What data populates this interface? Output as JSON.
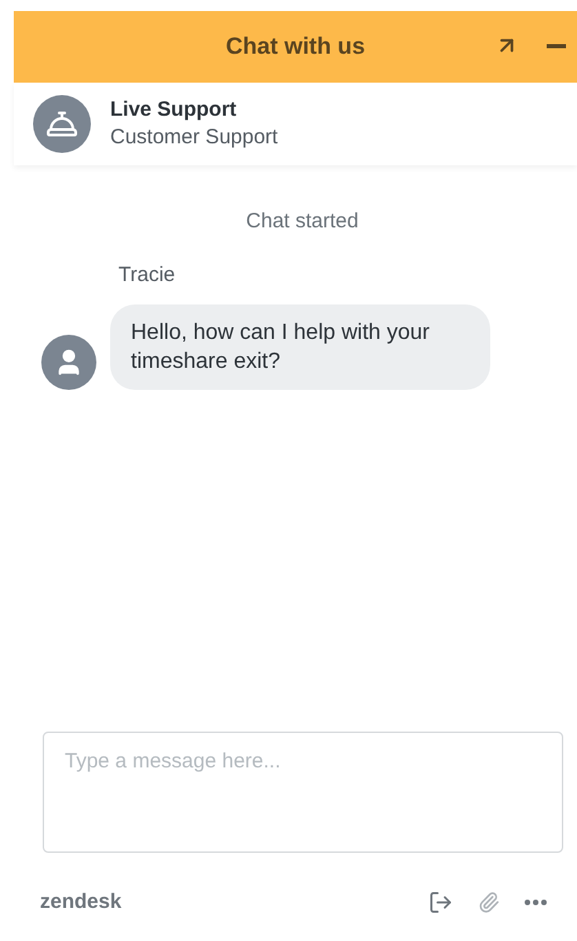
{
  "header": {
    "title": "Chat with us"
  },
  "agent": {
    "name": "Live Support",
    "department": "Customer Support"
  },
  "status": "Chat started",
  "messages": [
    {
      "sender": "Tracie",
      "text": "Hello, how can I help with your timeshare exit?"
    }
  ],
  "composer": {
    "placeholder": "Type a message here..."
  },
  "footer": {
    "brand": "zendesk"
  }
}
